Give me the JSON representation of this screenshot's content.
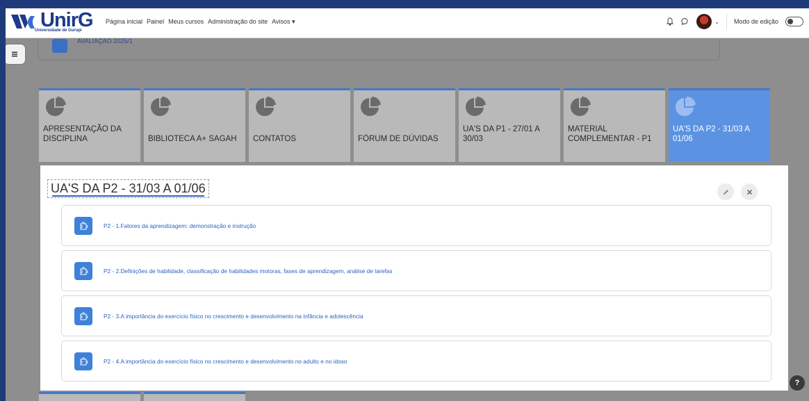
{
  "brand": {
    "name": "UnirG",
    "subtitle": "Universidade de Gurupi"
  },
  "nav": {
    "links": [
      "Página inicial",
      "Painel",
      "Meus cursos",
      "Administração do site",
      "Avisos ▾"
    ],
    "edit_mode_label": "Modo de edição"
  },
  "prev_section": {
    "label": "AVALIAÇÃO 2025/1"
  },
  "tiles": [
    {
      "label": "APRESENTAÇÃO DA DISCIPLINA"
    },
    {
      "label": "BIBLIOTECA A+ SAGAH"
    },
    {
      "label": "CONTATOS"
    },
    {
      "label": "FÓRUM DE DÚVIDAS"
    },
    {
      "label": "UA'S DA P1 - 27/01 A 30/03"
    },
    {
      "label": "MATERIAL COMPLEMENTAR - P1"
    },
    {
      "label": "UA'S DA P2 - 31/03 A 01/06",
      "active": true
    }
  ],
  "section": {
    "title": "UA'S DA P2 - 31/03 A 01/06",
    "activities": [
      "P2 - 1.Fatores da aprendizagem: demonstração e instrução",
      "P2 - 2.Definições de habilidade, classificação de habilidades motoras, fases de aprendizagem, análise de tarefas",
      "P2 - 3.A importância do exercício físico no crescimento e desenvolvimento na infância e adolescência",
      "P2 - 4.A importância do exercício físico no crescimento e desenvolvimento no adulto e no idoso"
    ]
  },
  "help": {
    "label": "?"
  },
  "colors": {
    "accent": "#4478c9",
    "active_tile": "#5b93e2",
    "link": "#2a62c2",
    "brand": "#1f3a8a"
  },
  "icons": [
    "bell-icon",
    "chat-icon",
    "chevron-down-icon",
    "drawer-icon",
    "pie-chart-icon",
    "pencil-icon",
    "close-icon",
    "puzzle-icon",
    "help-icon"
  ]
}
